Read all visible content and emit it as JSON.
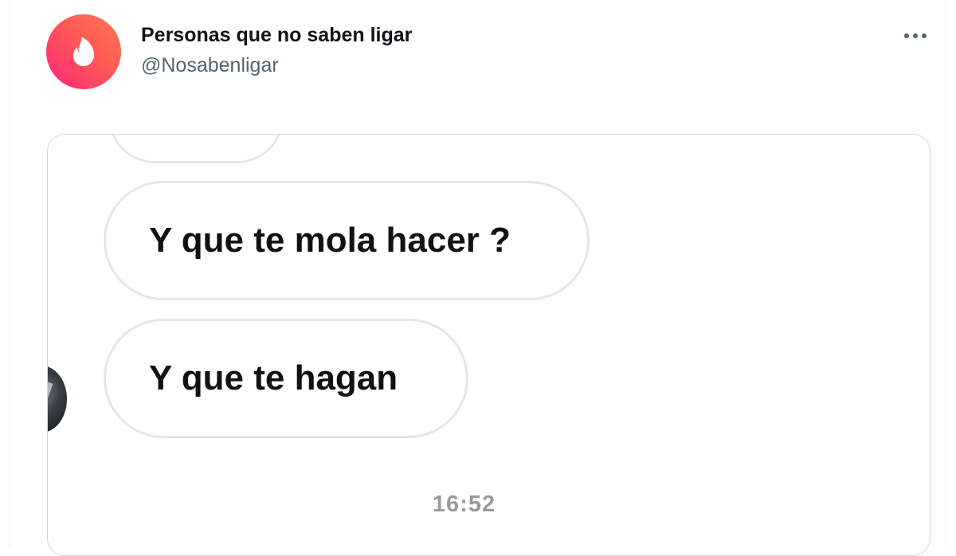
{
  "tweet": {
    "display_name": "Personas que no saben ligar",
    "handle": "@Nosabenligar",
    "avatar_icon": "tinder-flame-icon",
    "more_icon": "more-options-icon",
    "colors": {
      "avatar_gradient_start": "#fd267d",
      "avatar_gradient_end": "#ff7854",
      "name": "#0f1419",
      "handle": "#536471"
    }
  },
  "chat": {
    "messages": [
      {
        "text": "Y que te mola hacer ?"
      },
      {
        "text": "Y que te hagan"
      }
    ],
    "timestamp": "16:52",
    "sender_avatar_icon": "profile-photo"
  }
}
